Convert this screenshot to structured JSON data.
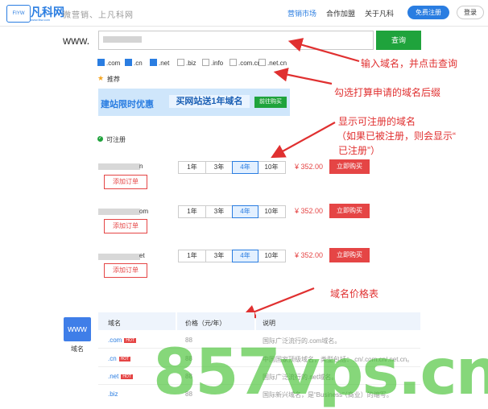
{
  "header": {
    "logo_box_text": "FIYW",
    "logo_text": "凡科网",
    "logo_sub": "www.fkw.com",
    "slogan": "微营销、上凡科网",
    "nav": [
      "营销市场",
      "合作加盟",
      "关于凡科"
    ],
    "register_label": "免费注册",
    "login_label": "登录",
    "accent_color": "#2a7de1"
  },
  "search": {
    "prefix": "www.",
    "button_label": "查询"
  },
  "suffixes": [
    {
      "label": ".com",
      "checked": true
    },
    {
      "label": ".cn",
      "checked": true
    },
    {
      "label": ".net",
      "checked": true
    },
    {
      "label": ".biz",
      "checked": false
    },
    {
      "label": ".info",
      "checked": false
    },
    {
      "label": ".com.cn",
      "checked": false
    },
    {
      "label": ".net.cn",
      "checked": false
    }
  ],
  "recommend": {
    "label": "推荐",
    "banner_text1": "建站限时优惠",
    "banner_text2": "买网站送1年域名",
    "banner_button": "前往购买"
  },
  "available": {
    "label": "可注册",
    "rows": [
      {
        "suffix_tail": "n",
        "add_label": "添加订单",
        "years": [
          "1年",
          "3年",
          "4年",
          "10年"
        ],
        "selected": "4年",
        "price": "¥ 352.00",
        "buy_label": "立即购买"
      },
      {
        "suffix_tail": "om",
        "add_label": "添加订单",
        "years": [
          "1年",
          "3年",
          "4年",
          "10年"
        ],
        "selected": "4年",
        "price": "¥ 352.00",
        "buy_label": "立即购买"
      },
      {
        "suffix_tail": "et",
        "add_label": "添加订单",
        "years": [
          "1年",
          "3年",
          "4年",
          "10年"
        ],
        "selected": "4年",
        "price": "¥ 352.00",
        "buy_label": "立即购买"
      }
    ]
  },
  "annotations": {
    "a1": "输入域名，并点击查询",
    "a2": "勾选打算申请的域名后缀",
    "a3_line1": "显示可注册的域名",
    "a3_line2": "（如果已被注册，则会显示“",
    "a3_line3": "已注册”）",
    "a4": "域名价格表",
    "color": "#e03030"
  },
  "price_table": {
    "side_label": "域名",
    "side_icon_text": "www",
    "headers": [
      "域名",
      "价格（元/年）",
      "说明"
    ],
    "rows": [
      {
        "domain": ".com",
        "hot": "HOT",
        "price": "88",
        "desc": "国际广泛流行的.com域名。"
      },
      {
        "domain": ".cn",
        "hot": "HOT",
        "price": "88",
        "desc": "中国国家顶级域名，类型包括：.cn/.com.cn/.net.cn。"
      },
      {
        "domain": ".net",
        "hot": "HOT",
        "price": "88",
        "desc": "国际广泛流行的.net域名。"
      },
      {
        "domain": ".biz",
        "hot": "",
        "price": "88",
        "desc": "国际新兴域名，是“Business”（商业）的缩写。"
      }
    ]
  },
  "watermark": "857vps.cn"
}
